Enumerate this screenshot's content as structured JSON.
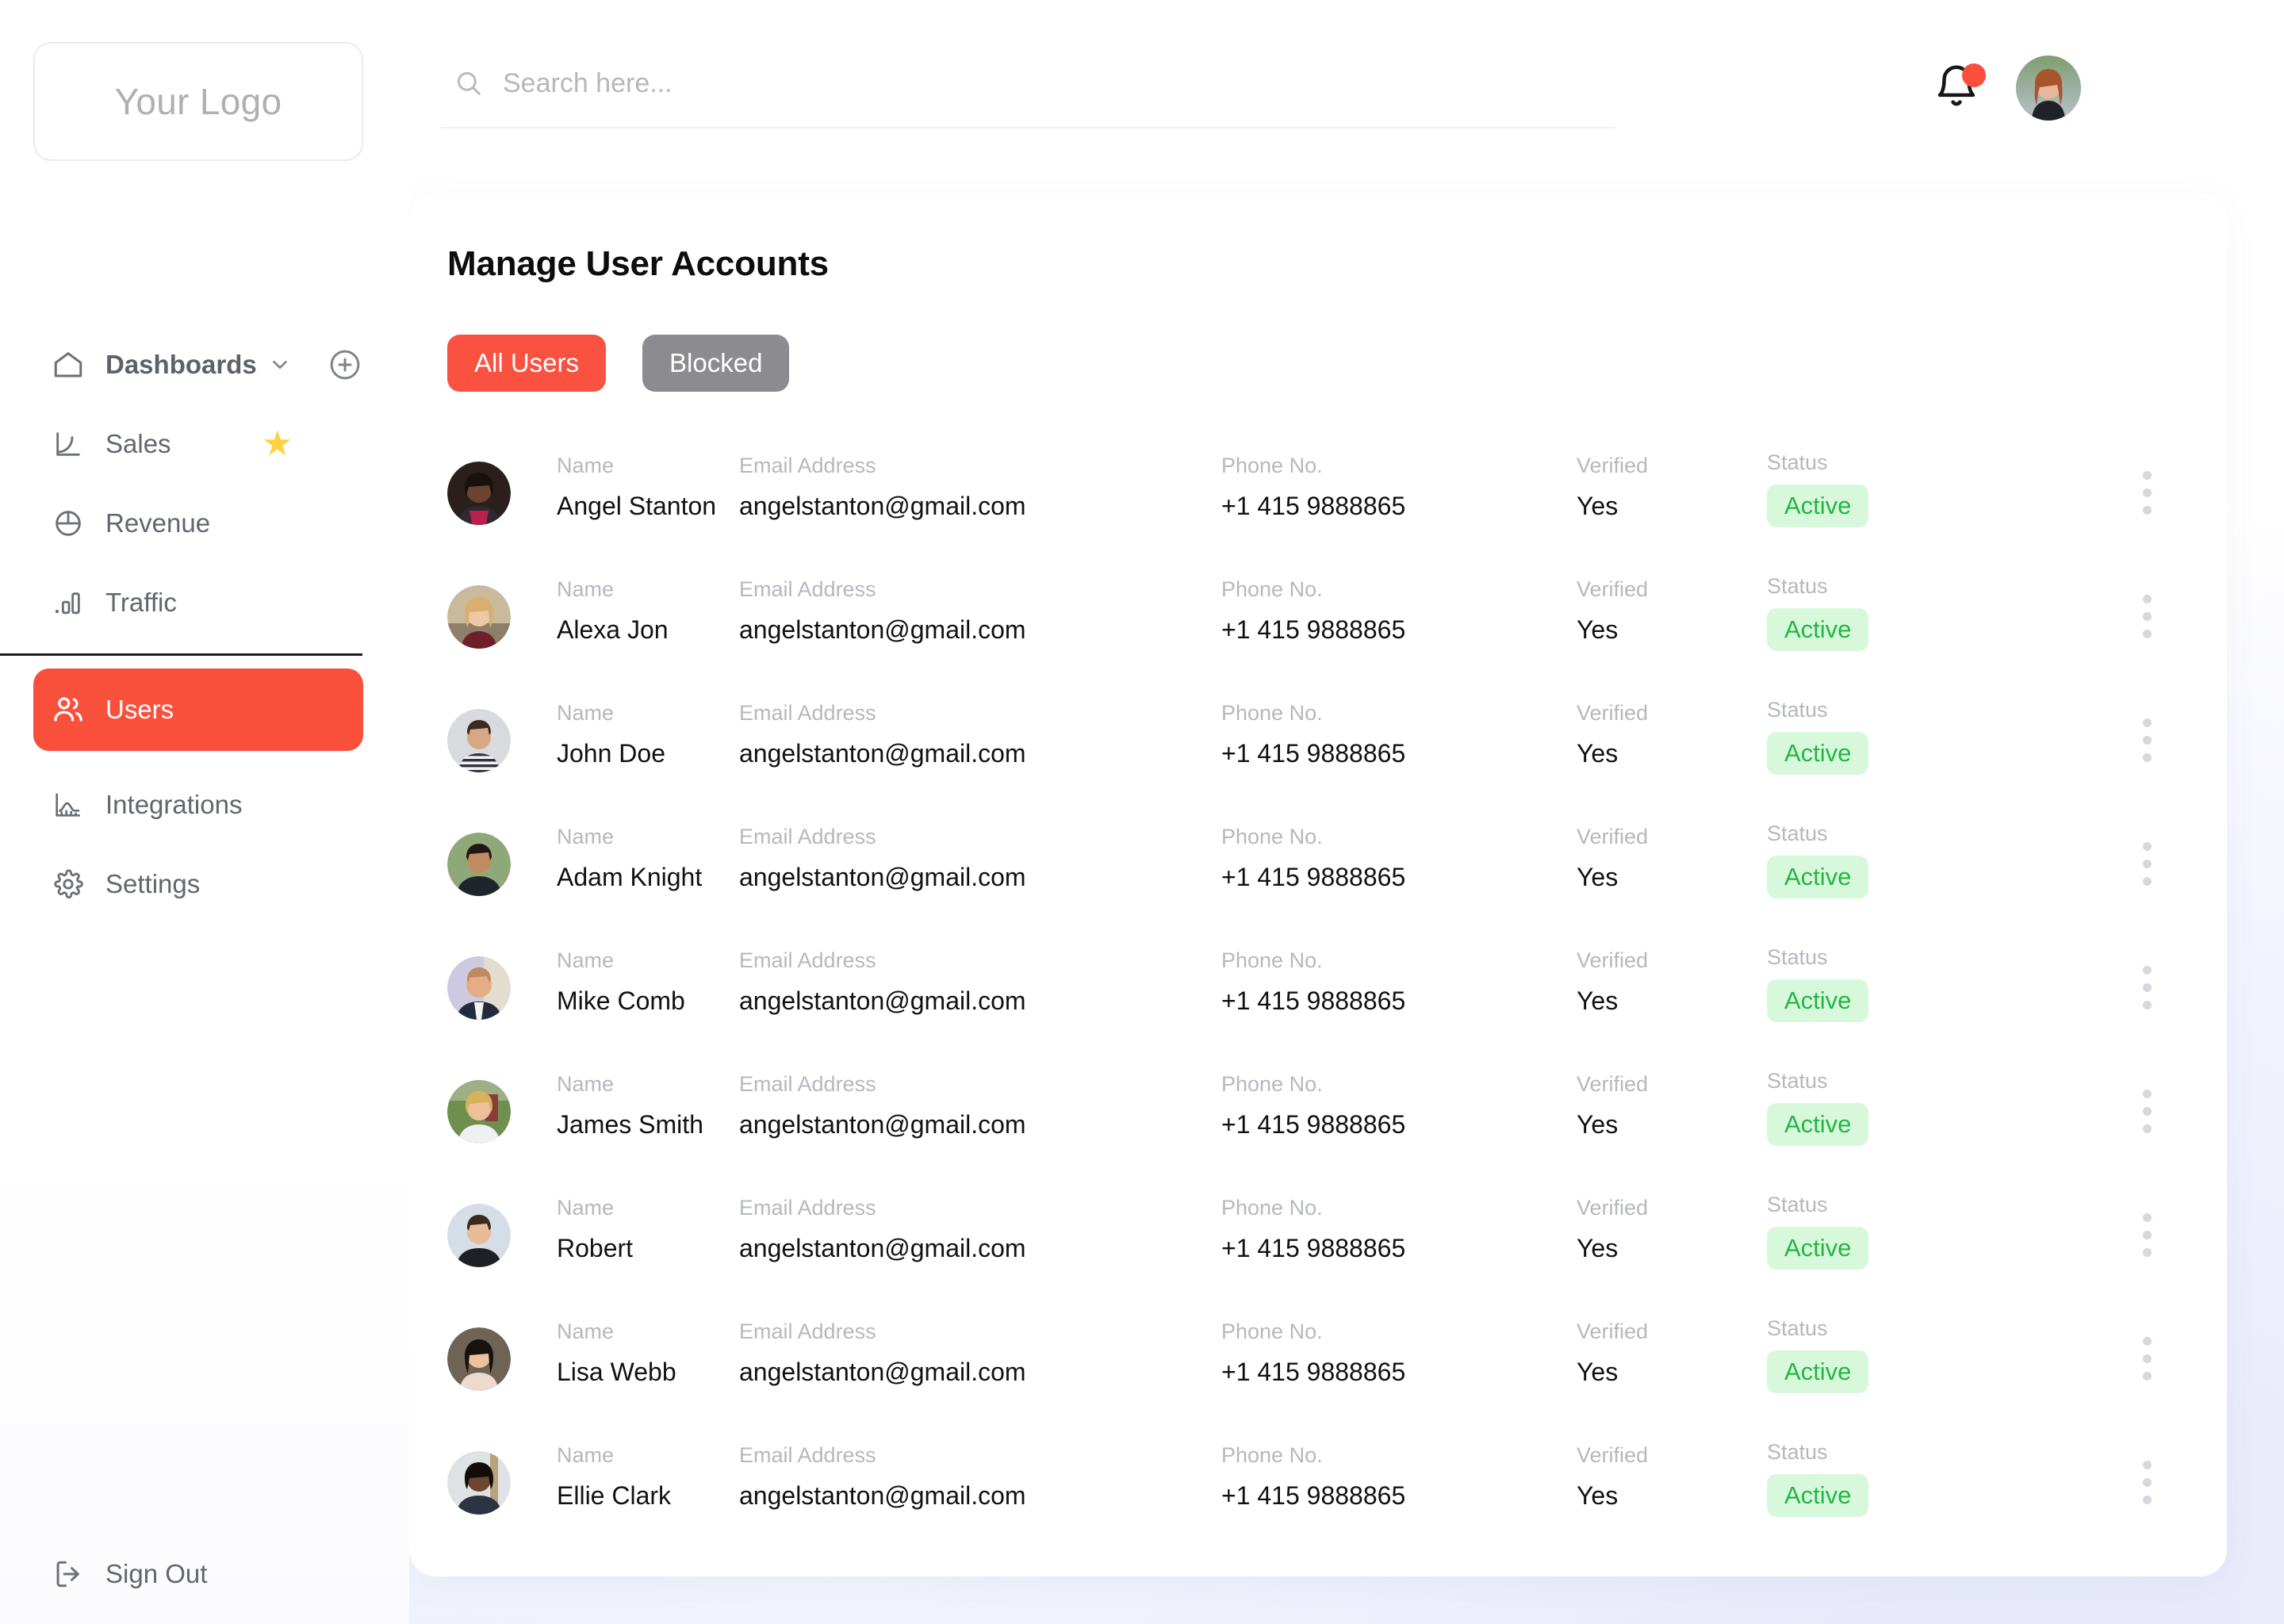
{
  "sidebar": {
    "logo": "Your Logo",
    "items": [
      {
        "label": "Dashboards",
        "icon": "home-icon",
        "has_chevron": true,
        "has_plus": true
      },
      {
        "label": "Sales",
        "icon": "chart-line-icon",
        "starred": true
      },
      {
        "label": "Revenue",
        "icon": "pie-chart-icon"
      },
      {
        "label": "Traffic",
        "icon": "bar-chart-icon"
      }
    ],
    "active_item": {
      "label": "Users",
      "icon": "users-icon"
    },
    "items_after": [
      {
        "label": "Integrations",
        "icon": "area-chart-icon"
      },
      {
        "label": "Settings",
        "icon": "gear-icon"
      }
    ],
    "sign_out": {
      "label": "Sign Out",
      "icon": "logout-icon"
    }
  },
  "topbar": {
    "search": {
      "placeholder": "Search here...",
      "value": "",
      "icon": "search-icon"
    },
    "notifications": {
      "icon": "bell-icon",
      "has_unread_dot": true
    },
    "avatar": {
      "icon": "avatar"
    }
  },
  "main": {
    "title": "Manage User Accounts",
    "tabs": [
      {
        "label": "All Users",
        "active": true
      },
      {
        "label": "Blocked",
        "active": false
      }
    ],
    "columns": {
      "name": "Name",
      "email": "Email Address",
      "phone": "Phone No.",
      "verified": "Verified",
      "status": "Status"
    },
    "row_menu_icon": "kebab-menu-icon",
    "rows": [
      {
        "name": "Angel Stanton",
        "email": "angelstanton@gmail.com",
        "phone": "+1 415 9888865",
        "verified": "Yes",
        "status": "Active"
      },
      {
        "name": "Alexa Jon",
        "email": "angelstanton@gmail.com",
        "phone": "+1 415 9888865",
        "verified": "Yes",
        "status": "Active"
      },
      {
        "name": "John Doe",
        "email": "angelstanton@gmail.com",
        "phone": "+1 415 9888865",
        "verified": "Yes",
        "status": "Active"
      },
      {
        "name": "Adam Knight",
        "email": "angelstanton@gmail.com",
        "phone": "+1 415 9888865",
        "verified": "Yes",
        "status": "Active"
      },
      {
        "name": "Mike Comb",
        "email": "angelstanton@gmail.com",
        "phone": "+1 415 9888865",
        "verified": "Yes",
        "status": "Active"
      },
      {
        "name": "James Smith",
        "email": "angelstanton@gmail.com",
        "phone": "+1 415 9888865",
        "verified": "Yes",
        "status": "Active"
      },
      {
        "name": "Robert",
        "email": "angelstanton@gmail.com",
        "phone": "+1 415 9888865",
        "verified": "Yes",
        "status": "Active"
      },
      {
        "name": "Lisa Webb",
        "email": "angelstanton@gmail.com",
        "phone": "+1 415 9888865",
        "verified": "Yes",
        "status": "Active"
      },
      {
        "name": "Ellie Clark",
        "email": "angelstanton@gmail.com",
        "phone": "+1 415 9888865",
        "verified": "Yes",
        "status": "Active"
      }
    ]
  },
  "colors": {
    "accent": "#fa5140",
    "inactive_tab": "#8c8c90",
    "status_text": "#23b643",
    "status_bg": "#d8f8dc",
    "star": "#ffd23f"
  }
}
